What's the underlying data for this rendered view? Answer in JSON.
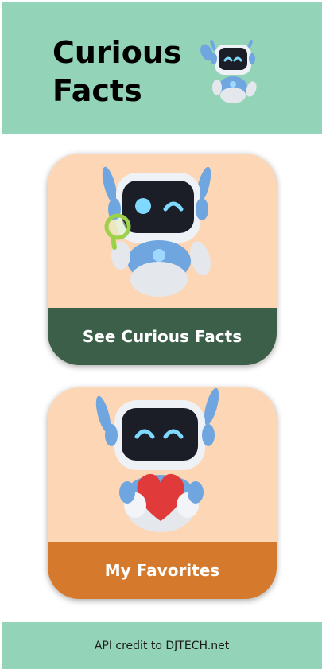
{
  "header": {
    "title_line1": "Curious",
    "title_line2": "Facts",
    "robot_icon": "waving-robot-icon"
  },
  "cards": [
    {
      "label": "See Curious Facts",
      "icon": "robot-magnifier-icon",
      "accent": "#3b5f49"
    },
    {
      "label": "My Favorites",
      "icon": "robot-heart-icon",
      "accent": "#d5792c"
    }
  ],
  "footer": {
    "credit": "API credit to DJTECH.net"
  },
  "colors": {
    "header_bg": "#93d3b8",
    "card_bg": "#fdd6b5"
  }
}
